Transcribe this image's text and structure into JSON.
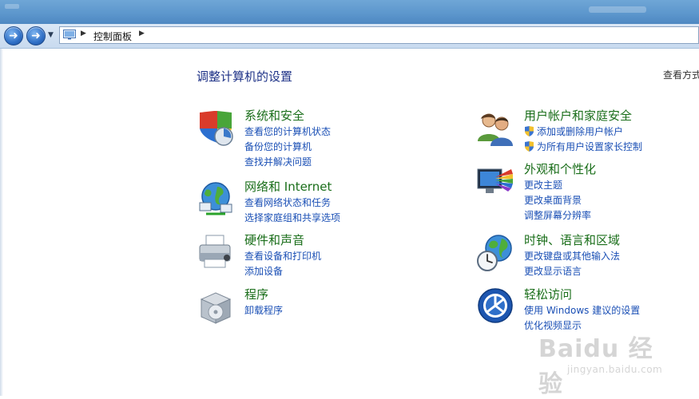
{
  "address": {
    "location": "控制面板"
  },
  "page": {
    "title": "调整计算机的设置",
    "view_by": "查看方式"
  },
  "categories": {
    "system_security": {
      "title": "系统和安全",
      "links": [
        "查看您的计算机状态",
        "备份您的计算机",
        "查找并解决问题"
      ]
    },
    "network": {
      "title": "网络和 Internet",
      "links": [
        "查看网络状态和任务",
        "选择家庭组和共享选项"
      ]
    },
    "hardware": {
      "title": "硬件和声音",
      "links": [
        "查看设备和打印机",
        "添加设备"
      ]
    },
    "programs": {
      "title": "程序",
      "links": [
        "卸载程序"
      ]
    },
    "user_accounts": {
      "title": "用户帐户和家庭安全",
      "links": [
        "添加或删除用户帐户",
        "为所有用户设置家长控制"
      ]
    },
    "appearance": {
      "title": "外观和个性化",
      "links": [
        "更改主题",
        "更改桌面背景",
        "调整屏幕分辨率"
      ]
    },
    "clock_region": {
      "title": "时钟、语言和区域",
      "links": [
        "更改键盘或其他输入法",
        "更改显示语言"
      ]
    },
    "ease_of_access": {
      "title": "轻松访问",
      "links": [
        "使用 Windows 建议的设置",
        "优化视频显示"
      ]
    }
  },
  "watermark": {
    "logo": "Baidu 经验",
    "url": "jingyan.baidu.com"
  },
  "colors": {
    "heading_green": "#1a6e1a",
    "link_blue": "#1a4fb5",
    "title_blue": "#1e3287"
  }
}
